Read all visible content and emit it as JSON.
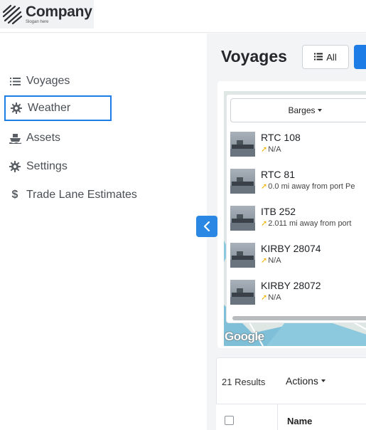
{
  "header": {
    "logo_name": "Company",
    "logo_slogan": "Slogan here"
  },
  "sidebar": {
    "items": [
      {
        "label": "Voyages",
        "icon": "list-icon"
      },
      {
        "label": "Weather",
        "icon": "gear-icon",
        "active": true
      },
      {
        "label": "Assets",
        "icon": "ship-icon"
      },
      {
        "label": "Settings",
        "icon": "gear-icon"
      },
      {
        "label": "Trade Lane Estimates",
        "icon": "dollar-icon"
      }
    ]
  },
  "main": {
    "title": "Voyages",
    "all_button": "All",
    "barges_dropdown": "Barges",
    "vessels": [
      {
        "name": "RTC 108",
        "status": "N/A"
      },
      {
        "name": "RTC 81",
        "status": "0.0 mi away from port Pe"
      },
      {
        "name": "ITB 252",
        "status": "2.011 mi away from port"
      },
      {
        "name": "KIRBY 28074",
        "status": "N/A"
      },
      {
        "name": "KIRBY 28072",
        "status": "N/A"
      }
    ],
    "map_attribution": "Google",
    "results_count": "21 Results",
    "actions_label": "Actions",
    "table_columns": [
      "Name"
    ]
  },
  "colors": {
    "accent": "#1e7ce6",
    "active_outline": "#1e7ce6",
    "status_arrow": "#f0b400"
  }
}
